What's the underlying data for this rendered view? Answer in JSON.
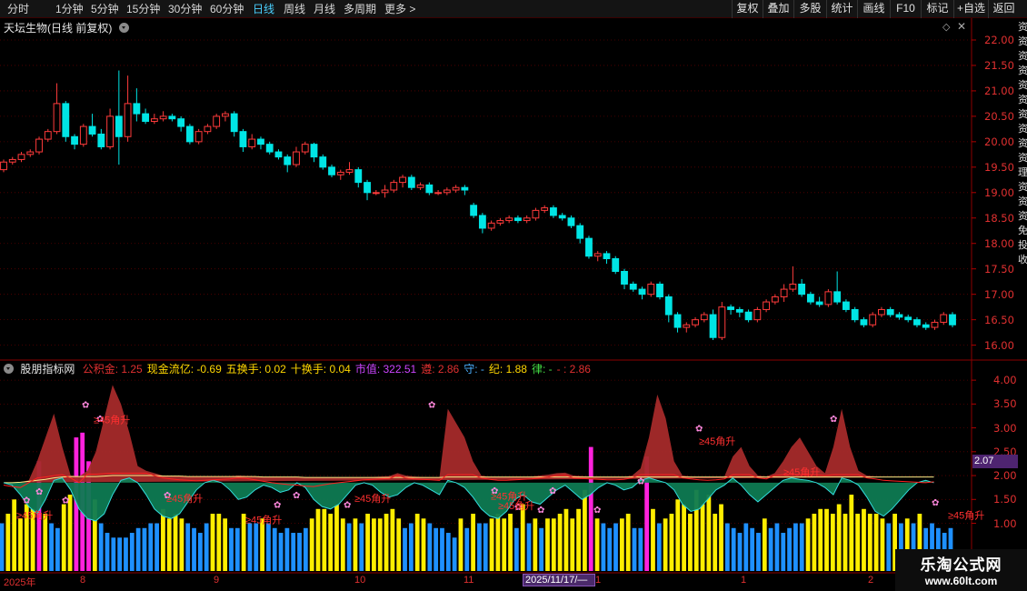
{
  "toolbar": {
    "periods": [
      "分时",
      "1分钟",
      "5分钟",
      "15分钟",
      "30分钟",
      "60分钟",
      "日线",
      "周线",
      "月线",
      "多周期",
      "更多 >"
    ],
    "active_period": "日线",
    "right_buttons": [
      "复权",
      "叠加",
      "多股",
      "统计",
      "画线",
      "F10",
      "标记",
      "+自选",
      "返回"
    ]
  },
  "price_panel": {
    "title": "天坛生物(日线 前复权)",
    "y_ticks": [
      "22.00",
      "21.50",
      "21.00",
      "20.50",
      "20.00",
      "19.50",
      "19.00",
      "18.50",
      "18.00",
      "17.50",
      "17.00",
      "16.50",
      "16.00"
    ]
  },
  "indicator_panel": {
    "name": "股朋指标网",
    "fields": [
      {
        "label": "公积金: ",
        "value": "1.25",
        "color": "#e03030"
      },
      {
        "label": "现金流亿: ",
        "value": "-0.69",
        "color": "#ffd700"
      },
      {
        "label": "五换手: ",
        "value": "0.02",
        "color": "#ffd700"
      },
      {
        "label": "十换手: ",
        "value": "0.04",
        "color": "#ffd700"
      },
      {
        "label": "市值: ",
        "value": "322.51",
        "color": "#cc44ff"
      },
      {
        "label": "遵: ",
        "value": "2.86",
        "color": "#e03030"
      },
      {
        "label": "守: ",
        "value": "-",
        "color": "#4ab0ff"
      },
      {
        "label": "纪: ",
        "value": "1.88",
        "color": "#ffd700"
      },
      {
        "label": "律: ",
        "value": "-",
        "color": "#44dd44"
      },
      {
        "label": "- : ",
        "value": "2.86",
        "color": "#e03030"
      }
    ],
    "y_ticks": [
      "4.00",
      "3.50",
      "3.00",
      "2.50",
      "2.00",
      "1.50",
      "1.00"
    ],
    "current_value": "2.07",
    "annotation_text": "≥45角升"
  },
  "date_axis": {
    "labels": [
      "2025年",
      "8",
      "9",
      "10",
      "11",
      "1",
      "2",
      "1",
      "2"
    ],
    "current_date": "2025/11/17/—"
  },
  "watermark": {
    "line1": "乐淘公式网",
    "line2": "www.60lt.com"
  },
  "right_strip_text": "资资资资资资资资资资理资资资免投收",
  "colors": {
    "up": "#ff3b3b",
    "down": "#00e5e5",
    "grid": "#5a0000",
    "fill_red": "#a52a2a",
    "fill_green": "#0e7a52",
    "bar_yellow": "#ffee00",
    "bar_blue": "#1e90ff",
    "bar_magenta": "#ff22dd"
  },
  "chart_data": {
    "type": "candlestick",
    "series_price": {
      "ylim": [
        15.85,
        22.25
      ],
      "ohlc": [
        [
          19.45,
          19.65,
          19.4,
          19.6
        ],
        [
          19.6,
          19.7,
          19.55,
          19.65
        ],
        [
          19.65,
          19.8,
          19.6,
          19.75
        ],
        [
          19.75,
          19.85,
          19.7,
          19.8
        ],
        [
          19.8,
          20.1,
          19.75,
          20.05
        ],
        [
          20.05,
          20.25,
          20.0,
          20.2
        ],
        [
          20.2,
          21.15,
          20.15,
          20.75
        ],
        [
          20.75,
          20.8,
          20.0,
          20.1
        ],
        [
          20.1,
          20.15,
          19.85,
          19.95
        ],
        [
          19.95,
          20.35,
          19.9,
          20.3
        ],
        [
          20.3,
          20.55,
          20.1,
          20.15
        ],
        [
          20.15,
          20.25,
          19.85,
          19.9
        ],
        [
          19.9,
          20.65,
          19.85,
          20.5
        ],
        [
          20.5,
          21.4,
          19.55,
          20.1
        ],
        [
          20.1,
          21.3,
          20.0,
          20.75
        ],
        [
          20.75,
          21.05,
          20.4,
          20.55
        ],
        [
          20.55,
          20.65,
          20.35,
          20.4
        ],
        [
          20.4,
          20.55,
          20.35,
          20.45
        ],
        [
          20.45,
          20.6,
          20.4,
          20.5
        ],
        [
          20.5,
          20.55,
          20.4,
          20.45
        ],
        [
          20.45,
          20.5,
          20.2,
          20.3
        ],
        [
          20.3,
          20.35,
          19.95,
          20.0
        ],
        [
          20.0,
          20.25,
          19.95,
          20.2
        ],
        [
          20.2,
          20.35,
          20.15,
          20.3
        ],
        [
          20.3,
          20.55,
          20.25,
          20.5
        ],
        [
          20.5,
          20.6,
          20.4,
          20.55
        ],
        [
          20.55,
          20.6,
          20.1,
          20.2
        ],
        [
          20.2,
          20.25,
          19.8,
          19.9
        ],
        [
          19.9,
          20.15,
          19.85,
          20.05
        ],
        [
          20.05,
          20.1,
          19.85,
          19.95
        ],
        [
          19.95,
          20.0,
          19.75,
          19.8
        ],
        [
          19.8,
          19.85,
          19.65,
          19.7
        ],
        [
          19.7,
          19.75,
          19.4,
          19.55
        ],
        [
          19.55,
          19.9,
          19.5,
          19.8
        ],
        [
          19.8,
          20.0,
          19.75,
          19.95
        ],
        [
          19.95,
          19.98,
          19.6,
          19.7
        ],
        [
          19.7,
          19.75,
          19.45,
          19.5
        ],
        [
          19.5,
          19.55,
          19.3,
          19.35
        ],
        [
          19.35,
          19.45,
          19.25,
          19.4
        ],
        [
          19.4,
          19.6,
          19.35,
          19.45
        ],
        [
          19.45,
          19.5,
          19.1,
          19.2
        ],
        [
          19.2,
          19.25,
          18.85,
          19.0
        ],
        [
          19.0,
          19.05,
          18.95,
          19.0
        ],
        [
          19.0,
          19.15,
          18.9,
          19.05
        ],
        [
          19.05,
          19.25,
          19.0,
          19.2
        ],
        [
          19.2,
          19.35,
          19.1,
          19.3
        ],
        [
          19.3,
          19.35,
          19.05,
          19.1
        ],
        [
          19.1,
          19.2,
          19.05,
          19.15
        ],
        [
          19.15,
          19.2,
          18.95,
          19.0
        ],
        [
          19.0,
          19.05,
          18.95,
          19.0
        ],
        [
          19.0,
          19.1,
          18.95,
          19.05
        ],
        [
          19.05,
          19.15,
          19.0,
          19.1
        ],
        [
          19.1,
          19.15,
          18.95,
          19.05
        ],
        [
          18.75,
          18.8,
          18.5,
          18.55
        ],
        [
          18.55,
          18.6,
          18.2,
          18.3
        ],
        [
          18.3,
          18.45,
          18.25,
          18.4
        ],
        [
          18.4,
          18.5,
          18.35,
          18.45
        ],
        [
          18.45,
          18.55,
          18.4,
          18.5
        ],
        [
          18.5,
          18.55,
          18.4,
          18.45
        ],
        [
          18.45,
          18.55,
          18.4,
          18.5
        ],
        [
          18.5,
          18.7,
          18.45,
          18.65
        ],
        [
          18.65,
          18.75,
          18.6,
          18.7
        ],
        [
          18.7,
          18.75,
          18.5,
          18.55
        ],
        [
          18.55,
          18.6,
          18.45,
          18.5
        ],
        [
          18.5,
          18.55,
          18.3,
          18.35
        ],
        [
          18.35,
          18.4,
          18.0,
          18.1
        ],
        [
          18.1,
          18.15,
          17.7,
          17.75
        ],
        [
          17.75,
          17.85,
          17.65,
          17.8
        ],
        [
          17.8,
          17.85,
          17.6,
          17.7
        ],
        [
          17.7,
          17.75,
          17.4,
          17.45
        ],
        [
          17.45,
          17.5,
          17.1,
          17.2
        ],
        [
          17.2,
          17.25,
          17.05,
          17.1
        ],
        [
          17.1,
          17.15,
          16.9,
          17.0
        ],
        [
          17.0,
          17.25,
          16.95,
          17.2
        ],
        [
          17.2,
          17.25,
          16.9,
          16.95
        ],
        [
          16.95,
          17.0,
          16.45,
          16.6
        ],
        [
          16.6,
          16.65,
          16.25,
          16.35
        ],
        [
          16.35,
          16.45,
          16.25,
          16.4
        ],
        [
          16.4,
          16.55,
          16.35,
          16.5
        ],
        [
          16.5,
          16.65,
          16.45,
          16.6
        ],
        [
          16.6,
          16.7,
          16.1,
          16.15
        ],
        [
          16.15,
          16.85,
          16.1,
          16.75
        ],
        [
          16.75,
          16.8,
          16.6,
          16.7
        ],
        [
          16.7,
          16.75,
          16.55,
          16.65
        ],
        [
          16.65,
          16.7,
          16.45,
          16.5
        ],
        [
          16.5,
          16.75,
          16.45,
          16.7
        ],
        [
          16.7,
          16.9,
          16.65,
          16.85
        ],
        [
          16.85,
          17.0,
          16.8,
          16.95
        ],
        [
          16.95,
          17.2,
          16.85,
          17.1
        ],
        [
          17.1,
          17.55,
          17.05,
          17.2
        ],
        [
          17.2,
          17.3,
          16.95,
          17.0
        ],
        [
          17.0,
          17.05,
          16.8,
          16.85
        ],
        [
          16.85,
          16.95,
          16.75,
          16.8
        ],
        [
          16.8,
          17.1,
          16.75,
          17.05
        ],
        [
          17.05,
          17.45,
          16.8,
          16.85
        ],
        [
          16.85,
          16.9,
          16.65,
          16.7
        ],
        [
          16.7,
          16.75,
          16.45,
          16.5
        ],
        [
          16.5,
          16.55,
          16.35,
          16.4
        ],
        [
          16.4,
          16.65,
          16.35,
          16.6
        ],
        [
          16.6,
          16.75,
          16.55,
          16.7
        ],
        [
          16.7,
          16.75,
          16.55,
          16.6
        ],
        [
          16.6,
          16.65,
          16.5,
          16.55
        ],
        [
          16.55,
          16.6,
          16.45,
          16.5
        ],
        [
          16.5,
          16.55,
          16.35,
          16.4
        ],
        [
          16.4,
          16.45,
          16.3,
          16.35
        ],
        [
          16.35,
          16.5,
          16.3,
          16.45
        ],
        [
          16.45,
          16.65,
          16.4,
          16.6
        ],
        [
          16.6,
          16.65,
          16.35,
          16.4
        ]
      ]
    },
    "series_indicator": {
      "ylim": [
        0.0,
        4.25
      ],
      "area_line": [
        1.85,
        1.82,
        1.8,
        1.9,
        2.3,
        2.8,
        3.3,
        2.6,
        2.0,
        1.9,
        2.1,
        2.5,
        3.2,
        3.9,
        3.5,
        2.9,
        2.2,
        2.1,
        2.05,
        2.0,
        1.98,
        1.96,
        1.95,
        1.94,
        1.95,
        1.96,
        1.97,
        1.98,
        2.0,
        1.99,
        1.96,
        1.93,
        1.9,
        1.88,
        1.86,
        1.85,
        1.83,
        1.82,
        1.85,
        1.88,
        1.9,
        1.92,
        1.94,
        1.96,
        1.97,
        1.98,
        1.99,
        2.05,
        2.0,
        1.98,
        1.97,
        1.96,
        1.95,
        3.4,
        3.1,
        2.8,
        2.3,
        2.0,
        1.97,
        1.95,
        1.95,
        1.96,
        1.97,
        1.98,
        2.0,
        2.02,
        2.05,
        2.06,
        2.0,
        1.99,
        1.98,
        1.97,
        1.96,
        1.96,
        1.97,
        2.0,
        2.15,
        2.8,
        3.7,
        3.2,
        2.3,
        2.0,
        1.98,
        1.96,
        1.95,
        1.96,
        1.98,
        2.4,
        2.6,
        2.2,
        2.0,
        1.98,
        2.05,
        2.3,
        2.6,
        2.8,
        2.5,
        2.2,
        2.05,
        2.6,
        3.4,
        2.6,
        2.1,
        2.0,
        1.98,
        1.95,
        1.94,
        1.93,
        1.92,
        1.91,
        1.9,
        1.92,
        2.0,
        2.8
      ],
      "baseline": [
        1.85,
        1.85,
        1.86,
        1.88,
        1.9,
        1.92,
        1.95,
        1.97,
        1.98,
        1.98,
        1.98,
        1.98,
        1.99,
        2.0,
        2.0,
        2.0,
        2.0,
        2.0,
        2.0,
        1.99,
        1.99,
        1.99,
        1.98,
        1.98,
        1.98,
        1.98,
        1.98,
        1.98,
        1.98,
        1.98,
        1.98,
        1.97,
        1.97,
        1.97,
        1.97,
        1.97,
        1.96,
        1.96,
        1.96,
        1.96,
        1.96,
        1.96,
        1.96,
        1.96,
        1.96,
        1.96,
        1.96,
        1.96,
        1.96,
        1.96,
        1.96,
        1.96,
        1.96,
        1.97,
        1.97,
        1.97,
        1.97,
        1.97,
        1.97,
        1.97,
        1.97,
        1.97,
        1.97,
        1.97,
        1.97,
        1.97,
        1.97,
        1.97,
        1.97,
        1.97,
        1.97,
        1.97,
        1.97,
        1.97,
        1.97,
        1.97,
        1.97,
        1.97,
        1.97,
        1.97,
        1.97,
        1.97,
        1.97,
        1.97,
        1.97,
        1.97,
        1.97,
        1.97,
        1.97,
        1.97,
        1.97,
        1.97,
        1.97,
        1.97,
        1.97,
        1.97,
        1.97,
        1.97,
        1.97,
        1.97,
        1.97,
        1.97,
        1.97,
        1.97,
        1.97,
        1.97,
        1.97,
        1.97,
        1.97,
        1.97,
        1.97,
        1.97
      ],
      "green_line": [
        1.85,
        1.8,
        1.6,
        1.35,
        1.2,
        1.5,
        1.9,
        1.95,
        1.7,
        1.3,
        1.1,
        1.05,
        1.2,
        1.6,
        1.9,
        1.95,
        1.85,
        1.6,
        1.3,
        1.15,
        1.1,
        1.2,
        1.45,
        1.7,
        1.85,
        1.9,
        1.85,
        1.7,
        1.5,
        1.55,
        1.7,
        1.8,
        1.75,
        1.65,
        1.7,
        1.85,
        1.75,
        1.5,
        1.35,
        1.3,
        1.4,
        1.6,
        1.8,
        1.85,
        1.8,
        1.65,
        1.55,
        1.6,
        1.75,
        1.85,
        1.8,
        1.7,
        1.6,
        1.9,
        1.85,
        1.75,
        1.55,
        1.3,
        1.15,
        1.1,
        1.25,
        1.5,
        1.6,
        1.45,
        1.4,
        1.55,
        1.7,
        1.8,
        1.65,
        1.5,
        1.6,
        1.75,
        1.85,
        1.8,
        1.7,
        1.75,
        1.9,
        1.95,
        1.9,
        1.85,
        1.7,
        1.4,
        1.25,
        1.3,
        1.5,
        1.7,
        1.8,
        1.95,
        1.8,
        1.6,
        1.45,
        1.6,
        1.75,
        1.9,
        1.95,
        1.92,
        1.9,
        1.85,
        1.75,
        1.6,
        1.95,
        1.9,
        1.8,
        1.55,
        1.25,
        1.15,
        1.3,
        1.5,
        1.7,
        1.85,
        1.9,
        1.85,
        1.9,
        1.95
      ],
      "bars": [
        1.0,
        1.2,
        1.5,
        1.1,
        1.4,
        1.3,
        2.3,
        1.2,
        1.0,
        0.9,
        1.4,
        1.6,
        2.8,
        2.9,
        2.3,
        1.5,
        1.0,
        0.8,
        0.7,
        0.7,
        0.7,
        0.8,
        0.9,
        0.9,
        1.0,
        1.0,
        1.3,
        1.1,
        1.2,
        1.1,
        1.0,
        0.9,
        0.8,
        1.0,
        1.2,
        1.2,
        1.1,
        0.9,
        0.9,
        1.2,
        1.0,
        1.0,
        1.1,
        1.0,
        0.9,
        0.8,
        0.9,
        0.8,
        0.8,
        0.9,
        1.1,
        1.3,
        1.3,
        1.2,
        1.4,
        1.1,
        1.0,
        1.1,
        1.0,
        1.2,
        1.1,
        1.1,
        1.2,
        1.3,
        1.1,
        0.9,
        1.0,
        1.2,
        1.1,
        1.0,
        0.9,
        0.9,
        0.8,
        0.7,
        1.1,
        0.9,
        1.2,
        1.0,
        1.0,
        1.1,
        1.2,
        1.1,
        1.2,
        0.9,
        1.4,
        1.0,
        1.1,
        0.9,
        1.1,
        1.1,
        1.2,
        1.3,
        1.1,
        1.3,
        1.7,
        2.6,
        1.1,
        1.0,
        0.9,
        1.0,
        1.1,
        1.2,
        0.9,
        0.9,
        2.4,
        1.3,
        1.0,
        1.1,
        1.2,
        1.5,
        1.4,
        1.2,
        1.7,
        1.4,
        1.6,
        1.2,
        1.4,
        1.0,
        0.9,
        0.8,
        1.0,
        0.9,
        0.8,
        1.1,
        0.9,
        1.0,
        0.8,
        0.9,
        1.0,
        1.0,
        1.1,
        1.2,
        1.3,
        1.3,
        1.2,
        1.4,
        1.2,
        1.6,
        1.2,
        1.3,
        1.2,
        1.2,
        1.1,
        1.0,
        1.2,
        1.0,
        1.1,
        1.0,
        1.2,
        0.9,
        1.0,
        0.9,
        0.8,
        0.9
      ],
      "bar_colors": "mixed"
    }
  }
}
